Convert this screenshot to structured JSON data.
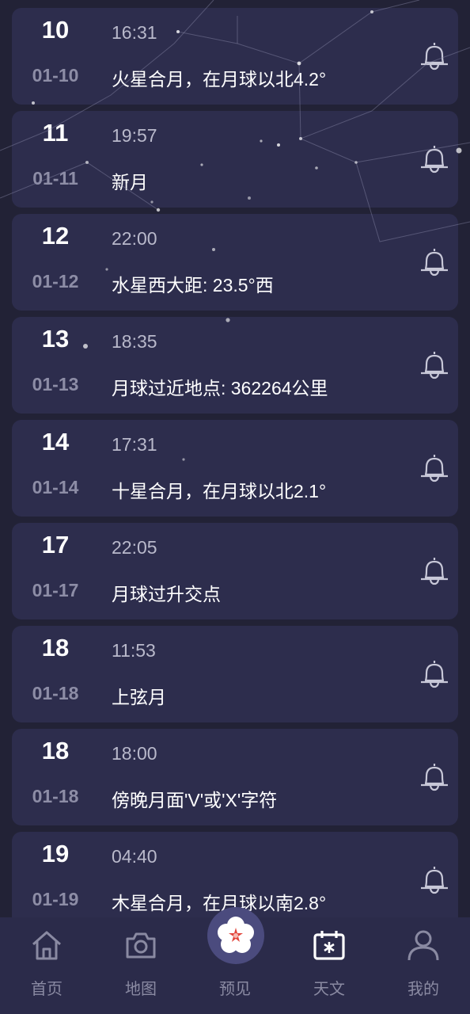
{
  "events": [
    {
      "day": "10",
      "date": "01-10",
      "time": "16:31",
      "event": "火星合月，在月球以北4.2°"
    },
    {
      "day": "11",
      "date": "01-11",
      "time": "19:57",
      "event": "新月"
    },
    {
      "day": "12",
      "date": "01-12",
      "time": "22:00",
      "event": "水星西大距: 23.5°西"
    },
    {
      "day": "13",
      "date": "01-13",
      "time": "18:35",
      "event": "月球过近地点: 362264公里"
    },
    {
      "day": "14",
      "date": "01-14",
      "time": "17:31",
      "event": "十星合月，在月球以北2.1°"
    },
    {
      "day": "17",
      "date": "01-17",
      "time": "22:05",
      "event": "月球过升交点"
    },
    {
      "day": "18",
      "date": "01-18",
      "time": "11:53",
      "event": "上弦月"
    },
    {
      "day": "18",
      "date": "01-18",
      "time": "18:00",
      "event": "傍晚月面'V'或'X'字符"
    },
    {
      "day": "19",
      "date": "01-19",
      "time": "04:40",
      "event": "木星合月，在月球以南2.8°"
    }
  ],
  "nav": {
    "home": "首页",
    "map": "地图",
    "preview": "预见",
    "astronomy": "天文",
    "mine": "我的"
  },
  "icons": {
    "bell": "bell-icon",
    "home": "home-icon",
    "camera": "camera-icon",
    "flower": "plum-blossom-icon",
    "calendar": "calendar-icon",
    "person": "person-icon"
  },
  "colors": {
    "background": "#222236",
    "card": "#2d2d4d",
    "nav": "#2b2b4a",
    "accent_center": "#4b4b7e",
    "flower_petal": "#ffffff",
    "flower_center": "#e2463c"
  }
}
